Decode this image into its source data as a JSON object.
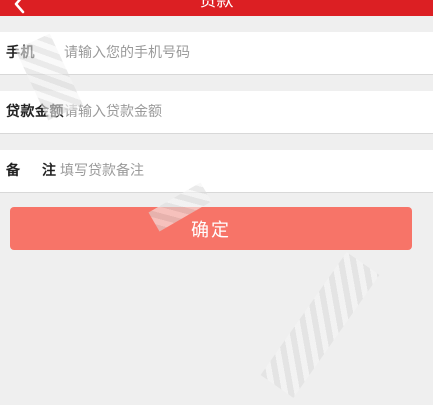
{
  "header": {
    "title": "贷款",
    "back_icon": "chevron-left-icon",
    "background_color": "#dc1f23"
  },
  "form": {
    "phone": {
      "label": "手机",
      "placeholder": "请输入您的手机号码"
    },
    "amount": {
      "label": "贷款金额",
      "placeholder": "请输入贷款金额"
    },
    "remark": {
      "label": "备    注",
      "placeholder": "填写贷款备注"
    }
  },
  "actions": {
    "confirm_label": "确定",
    "confirm_color": "#f77468"
  }
}
